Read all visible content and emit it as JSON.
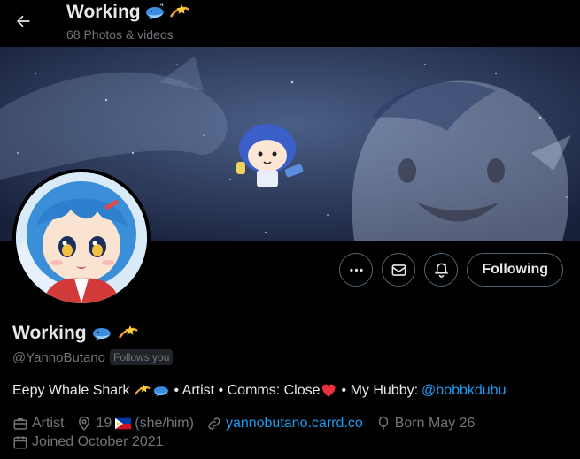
{
  "header": {
    "back_label": "Back",
    "title": "Working",
    "subtitle": "68 Photos & videos"
  },
  "profile": {
    "display_name": "Working",
    "handle": "@YannoButano",
    "follows_you_badge": "Follows you",
    "bio": {
      "text": "Eepy Whale Shark",
      "parts": [
        "• Artist • Comms: Close",
        "• My Hubby:"
      ],
      "mention": "@bobbkdubu"
    },
    "meta": {
      "profession": "Artist",
      "location_age": "19",
      "pronouns": "(she/him)",
      "website": "yannobutano.carrd.co",
      "birthday": "Born May 26",
      "joined": "Joined October 2021"
    }
  },
  "actions": {
    "more_icon": "more-icon",
    "message_icon": "message-icon",
    "notify_icon": "notify-bell-icon",
    "following_label": "Following"
  },
  "colors": {
    "accent": "#1d9bf0",
    "muted": "#71767b",
    "text": "#e7e9ea",
    "background": "#000000",
    "border": "#536471"
  }
}
